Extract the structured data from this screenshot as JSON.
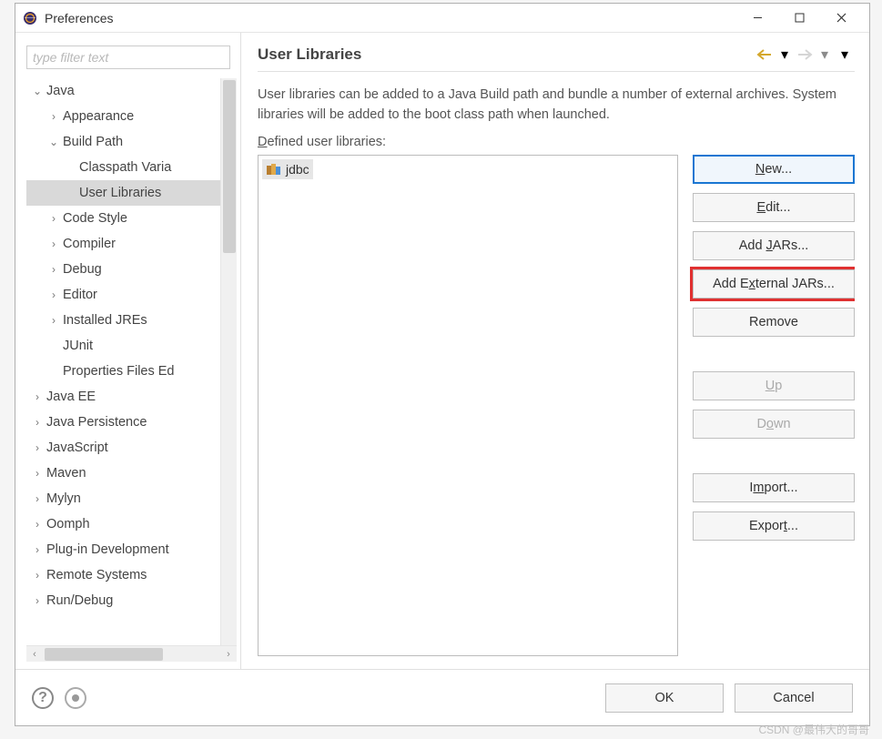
{
  "window": {
    "title": "Preferences",
    "filter_placeholder": "type filter text"
  },
  "tree": {
    "java": "Java",
    "appearance": "Appearance",
    "buildpath": "Build Path",
    "classpath_vars": "Classpath Varia",
    "user_libraries": "User Libraries",
    "code_style": "Code Style",
    "compiler": "Compiler",
    "debug": "Debug",
    "editor": "Editor",
    "installed_jres": "Installed JREs",
    "junit": "JUnit",
    "properties_files": "Properties Files Ed",
    "java_ee": "Java EE",
    "java_persistence": "Java Persistence",
    "javascript": "JavaScript",
    "maven": "Maven",
    "mylyn": "Mylyn",
    "oomph": "Oomph",
    "plugin_dev": "Plug-in Development",
    "remote_systems": "Remote Systems",
    "run_debug": "Run/Debug"
  },
  "page": {
    "heading": "User Libraries",
    "description": "User libraries can be added to a Java Build path and bundle a number of external archives. System libraries will be added to the boot class path when launched.",
    "defined_label_pre": "D",
    "defined_label_post": "efined user libraries:",
    "library_item": "jdbc"
  },
  "buttons": {
    "new": "New...",
    "edit": "Edit...",
    "add_jars": "Add JARs...",
    "add_external_jars": "Add External JARs...",
    "remove": "Remove",
    "up": "Up",
    "down": "Down",
    "import": "Import...",
    "export": "Export...",
    "ok": "OK",
    "cancel": "Cancel"
  },
  "watermark": "CSDN @最伟大的哥哥"
}
